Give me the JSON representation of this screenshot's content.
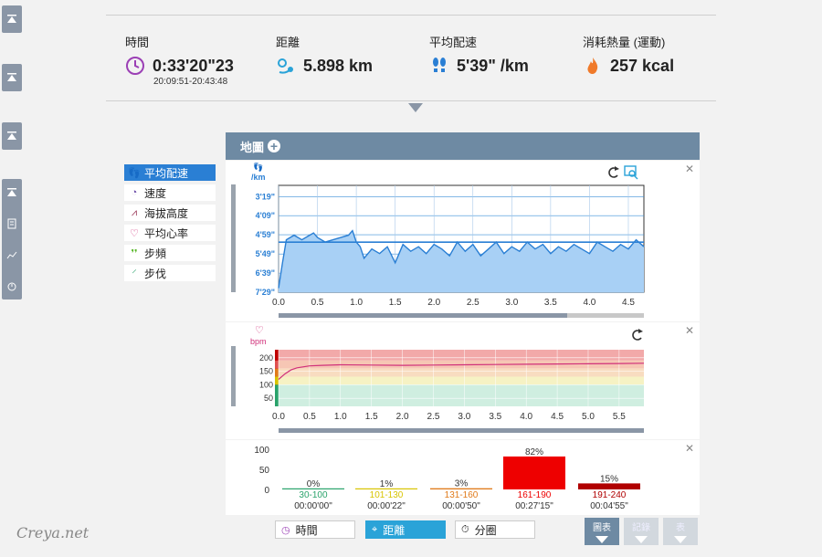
{
  "stats": {
    "time": {
      "label": "時間",
      "value": "0:33'20\"23",
      "sub": "20:09:51-20:43:48",
      "icon": "clock-icon"
    },
    "distance": {
      "label": "距離",
      "value": "5.898 km",
      "icon": "distance-icon"
    },
    "pace": {
      "label": "平均配速",
      "value": "5'39\" /km",
      "icon": "footsteps-icon"
    },
    "calories": {
      "label": "消耗熱量 (運動)",
      "value": "257 kcal",
      "icon": "flame-icon"
    }
  },
  "map_header": {
    "label": "地圖",
    "icon": "plus-circle-icon"
  },
  "side_menu": [
    {
      "label": "平均配速",
      "icon": "footsteps-icon",
      "active": true
    },
    {
      "label": "速度",
      "icon": "speedometer-icon",
      "active": false
    },
    {
      "label": "海拔高度",
      "icon": "elevation-icon",
      "active": false
    },
    {
      "label": "平均心率",
      "icon": "heart-icon",
      "active": false
    },
    {
      "label": "步頻",
      "icon": "steps-green-icon",
      "active": false
    },
    {
      "label": "步伐",
      "icon": "stride-icon",
      "active": false
    }
  ],
  "pace_chart": {
    "unit": "/km",
    "x_ticks": [
      "0.0",
      "0.5",
      "1.0",
      "1.5",
      "2.0",
      "2.5",
      "3.0",
      "3.5",
      "4.0",
      "4.5"
    ],
    "y_ticks": [
      "3'19\"",
      "4'09\"",
      "4'59\"",
      "5'49\"",
      "6'39\"",
      "7'29\""
    ]
  },
  "hr_chart": {
    "unit": "bpm",
    "x_ticks": [
      "0.0",
      "0.5",
      "1.0",
      "1.5",
      "2.0",
      "2.5",
      "3.0",
      "3.5",
      "4.0",
      "4.5",
      "5.0",
      "5.5"
    ],
    "y_ticks": [
      "200",
      "150",
      "100",
      "50"
    ]
  },
  "chart_data": [
    {
      "type": "area",
      "xlabel": "",
      "ylabel": "/km",
      "xlim": [
        0,
        4.7
      ],
      "ylim": [
        "7'29\"",
        "2'50\""
      ],
      "grid": true,
      "series": [
        {
          "x": [
            0.0,
            0.05,
            0.1,
            0.2,
            0.3,
            0.4,
            0.45,
            0.5,
            0.6,
            0.7,
            0.8,
            0.9,
            0.95,
            1.0,
            1.05,
            1.1,
            1.2,
            1.3,
            1.4,
            1.5,
            1.6,
            1.7,
            1.8,
            1.9,
            2.0,
            2.1,
            2.2,
            2.3,
            2.4,
            2.5,
            2.6,
            2.7,
            2.8,
            2.9,
            3.0,
            3.1,
            3.2,
            3.3,
            3.4,
            3.5,
            3.6,
            3.7,
            3.8,
            3.9,
            4.0,
            4.1,
            4.2,
            4.3,
            4.4,
            4.5,
            4.6,
            4.7
          ],
          "y": [
            7.3,
            6.2,
            5.2,
            5.0,
            5.2,
            5.0,
            4.9,
            5.1,
            5.3,
            5.2,
            5.1,
            5.0,
            4.8,
            5.3,
            5.5,
            6.0,
            5.6,
            5.8,
            5.5,
            6.2,
            5.4,
            5.7,
            5.5,
            5.8,
            5.4,
            5.6,
            5.9,
            5.3,
            5.7,
            5.4,
            5.9,
            5.6,
            5.3,
            5.8,
            5.5,
            5.7,
            5.3,
            5.6,
            5.4,
            5.8,
            5.5,
            5.7,
            5.4,
            5.6,
            5.8,
            5.3,
            5.5,
            5.7,
            5.4,
            5.6,
            5.2,
            5.5
          ]
        }
      ]
    },
    {
      "type": "line",
      "ylabel": "bpm",
      "xlim": [
        0,
        5.9
      ],
      "ylim": [
        20,
        230
      ],
      "zones": [
        "50",
        "100",
        "150",
        "200"
      ],
      "series": [
        {
          "x": [
            0.0,
            0.1,
            0.2,
            0.3,
            0.5,
            0.7,
            1.0,
            1.5,
            2.0,
            2.5,
            3.0,
            3.5,
            4.0,
            4.5,
            5.0,
            5.5,
            5.9
          ],
          "y": [
            120,
            140,
            155,
            163,
            170,
            172,
            174,
            173,
            172,
            173,
            174,
            175,
            176,
            177,
            178,
            179,
            180
          ]
        }
      ]
    },
    {
      "type": "bar",
      "categories": [
        "30-100",
        "101-130",
        "131-160",
        "161-190",
        "191-240"
      ],
      "values": [
        0,
        1,
        3,
        82,
        15
      ],
      "times": [
        "00:00'00\"",
        "00:00'22\"",
        "00:00'50\"",
        "00:27'15\"",
        "00:04'55\""
      ],
      "ylim": [
        0,
        100
      ],
      "y_ticks": [
        "100",
        "50",
        "0"
      ],
      "colors": [
        "#2aa36b",
        "#d8c400",
        "#e07a1a",
        "#ee0000",
        "#b00000"
      ]
    }
  ],
  "zone_labels": [
    "0%",
    "1%",
    "3%",
    "82%",
    "15%"
  ],
  "bottom_tabs": [
    {
      "label": "時間",
      "icon": "clock-icon",
      "active": false
    },
    {
      "label": "距離",
      "icon": "distance-icon",
      "active": true
    },
    {
      "label": "分圈",
      "icon": "stopwatch-icon",
      "active": false
    }
  ],
  "bottom_buttons": [
    {
      "label": "圖表",
      "active": true
    },
    {
      "label": "記錄",
      "active": false
    },
    {
      "label": "表",
      "active": false
    }
  ],
  "watermark": "Creya.net"
}
